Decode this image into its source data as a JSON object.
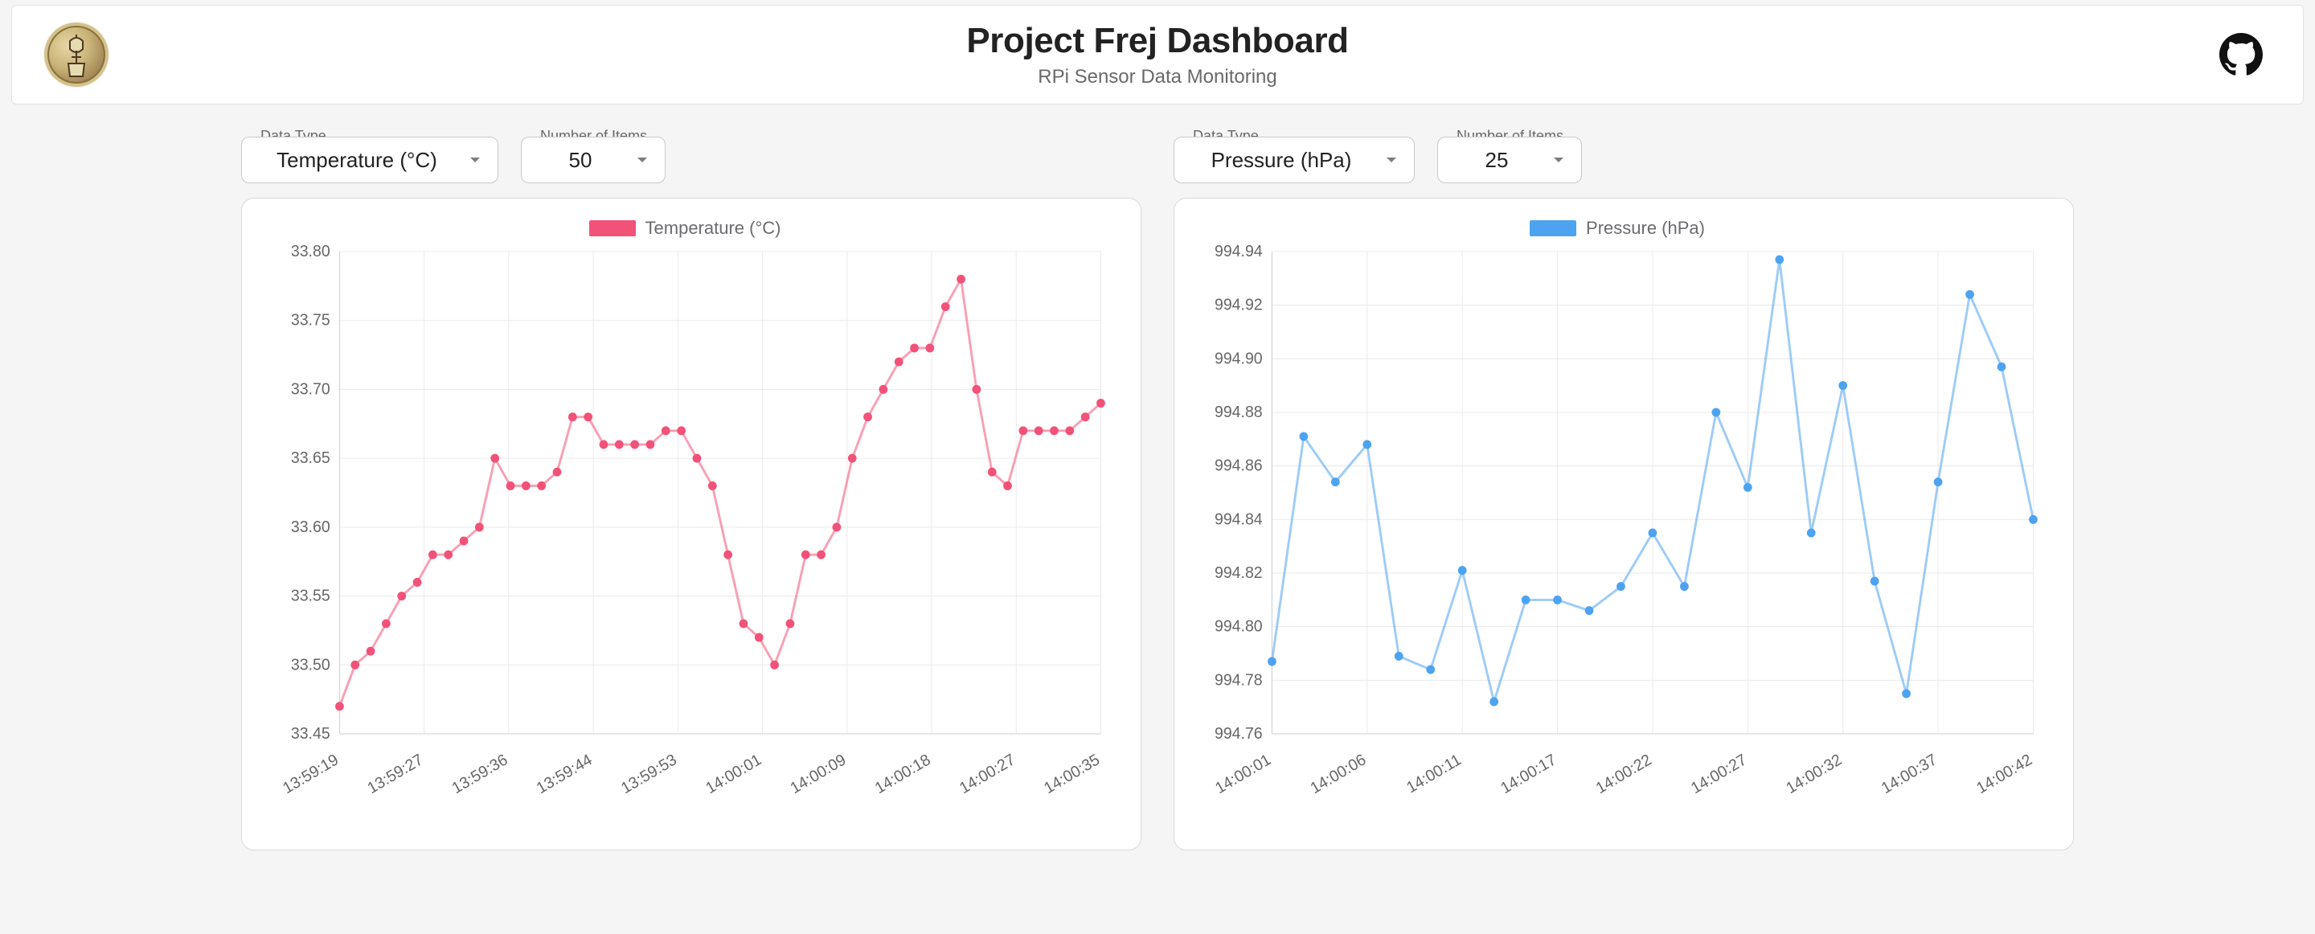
{
  "header": {
    "title": "Project Frej Dashboard",
    "subtitle": "RPi Sensor Data Monitoring"
  },
  "panel_left": {
    "controls": {
      "data_type": {
        "label": "Data Type",
        "value": "Temperature (°C)"
      },
      "num_items": {
        "label": "Number of Items",
        "value": "50"
      }
    }
  },
  "panel_right": {
    "controls": {
      "data_type": {
        "label": "Data Type",
        "value": "Pressure (hPa)"
      },
      "num_items": {
        "label": "Number of Items",
        "value": "25"
      }
    }
  },
  "chart_data": [
    {
      "type": "line",
      "title": "",
      "xlabel": "",
      "ylabel": "",
      "legend": "Temperature (°C)",
      "color": "#f25278",
      "ylim": [
        33.45,
        33.8
      ],
      "yticks": [
        33.45,
        33.5,
        33.55,
        33.6,
        33.65,
        33.7,
        33.75,
        33.8
      ],
      "xticks": [
        "13:59:19",
        "13:59:27",
        "13:59:36",
        "13:59:44",
        "13:59:53",
        "14:00:01",
        "14:00:09",
        "14:00:18",
        "14:00:27",
        "14:00:35"
      ],
      "x": [
        0,
        1,
        2,
        3,
        4,
        5,
        6,
        7,
        8,
        9,
        10,
        11,
        12,
        13,
        14,
        15,
        16,
        17,
        18,
        19,
        20,
        21,
        22,
        23,
        24,
        25,
        26,
        27,
        28,
        29,
        30,
        31,
        32,
        33,
        34,
        35,
        36,
        37,
        38,
        39,
        40,
        41,
        42,
        43,
        44,
        45,
        46,
        47,
        48,
        49
      ],
      "values": [
        33.47,
        33.5,
        33.51,
        33.53,
        33.55,
        33.56,
        33.58,
        33.58,
        33.59,
        33.6,
        33.65,
        33.63,
        33.63,
        33.63,
        33.64,
        33.68,
        33.68,
        33.66,
        33.66,
        33.66,
        33.66,
        33.67,
        33.67,
        33.65,
        33.63,
        33.58,
        33.53,
        33.52,
        33.5,
        33.53,
        33.58,
        33.58,
        33.6,
        33.65,
        33.68,
        33.7,
        33.72,
        33.73,
        33.73,
        33.76,
        33.78,
        33.7,
        33.64,
        33.63,
        33.67,
        33.67,
        33.67,
        33.67,
        33.68,
        33.69
      ]
    },
    {
      "type": "line",
      "title": "",
      "xlabel": "",
      "ylabel": "",
      "legend": "Pressure (hPa)",
      "color": "#4da3f0",
      "ylim": [
        994.76,
        994.94
      ],
      "yticks": [
        994.76,
        994.78,
        994.8,
        994.82,
        994.84,
        994.86,
        994.88,
        994.9,
        994.92,
        994.94
      ],
      "xticks": [
        "14:00:01",
        "14:00:06",
        "14:00:11",
        "14:00:17",
        "14:00:22",
        "14:00:27",
        "14:00:32",
        "14:00:37",
        "14:00:42"
      ],
      "x": [
        0,
        1,
        2,
        3,
        4,
        5,
        6,
        7,
        8,
        9,
        10,
        11,
        12,
        13,
        14,
        15,
        16,
        17,
        18,
        19,
        20,
        21,
        22,
        23,
        24
      ],
      "values": [
        994.787,
        994.871,
        994.854,
        994.868,
        994.789,
        994.784,
        994.821,
        994.772,
        994.81,
        994.81,
        994.806,
        994.815,
        994.835,
        994.815,
        994.88,
        994.852,
        994.937,
        994.835,
        994.89,
        994.817,
        994.775,
        994.854,
        994.924,
        994.897,
        994.84
      ]
    }
  ]
}
